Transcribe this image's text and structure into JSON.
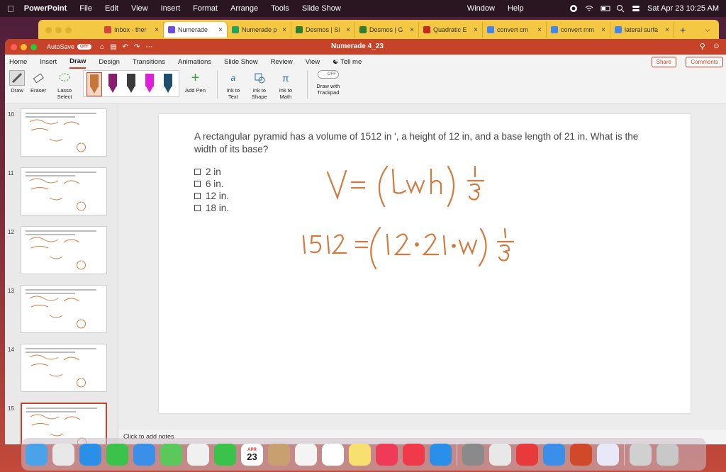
{
  "menubar": {
    "app": "PowerPoint",
    "items": [
      "File",
      "Edit",
      "View",
      "Insert",
      "Format",
      "Arrange",
      "Tools",
      "Slide Show"
    ],
    "window": "Window",
    "help": "Help",
    "datetime": "Sat Apr 23  10:25 AM"
  },
  "browser_tabs": [
    {
      "label": "Inbox - ther",
      "color": "#d44638"
    },
    {
      "label": "Numerade",
      "color": "#6a4ce0",
      "active": true
    },
    {
      "label": "Numerade p",
      "color": "#1fa463"
    },
    {
      "label": "Desmos | Si",
      "color": "#2e7d32"
    },
    {
      "label": "Desmos | G",
      "color": "#2e7d32"
    },
    {
      "label": "Quadratic E",
      "color": "#c62828"
    },
    {
      "label": "convert cm",
      "color": "#4285f4"
    },
    {
      "label": "convert mm",
      "color": "#4285f4"
    },
    {
      "label": "lateral surfa",
      "color": "#4285f4"
    }
  ],
  "ppt": {
    "autosave_label": "AutoSave",
    "autosave_state": "OFF",
    "doc_title": "Numerade 4_23",
    "ribbon_tabs": [
      "Home",
      "Insert",
      "Draw",
      "Design",
      "Transitions",
      "Animations",
      "Slide Show",
      "Review",
      "View",
      "Tell me"
    ],
    "share_label": "Share",
    "comments_label": "Comments",
    "tools": {
      "draw": "Draw",
      "eraser": "Eraser",
      "lasso": "Lasso Select",
      "add_pen": "Add Pen",
      "ink_text": "Ink to Text",
      "ink_shape": "Ink to Shape",
      "ink_math": "Ink to Math",
      "trackpad_toggle": "OFF",
      "trackpad": "Draw with Trackpad"
    },
    "pen_colors": [
      "#c6763a",
      "#8a1d6e",
      "#3a3a3a",
      "#e020d8",
      "#1f4e6e"
    ]
  },
  "thumbnails": [
    "10",
    "11",
    "12",
    "13",
    "14",
    "15"
  ],
  "slide": {
    "question": "A rectangular pyramid has a volume of 1512 in ', a height of 12 in, and a base length of 21 in. What is the width of its base?",
    "options": [
      "2 in",
      "6 in.",
      "12 in.",
      "18 in."
    ],
    "ink_line1": "V=(lwh)1/3",
    "ink_line2": "1512=(12·21·w)1/3",
    "ink_color": "#d07a40"
  },
  "notes_placeholder": "Click to add notes",
  "dock_apps": [
    "Finder",
    "Launchpad",
    "Safari",
    "Messages",
    "Mail",
    "Maps",
    "Photos",
    "FaceTime",
    "Calendar",
    "Contacts",
    "Reminders",
    "Chrome",
    "Notes",
    "Music",
    "News",
    "App Store",
    "System Preferences",
    "Vectorize",
    "Webex",
    "Zoom",
    "PowerPoint",
    "Numerade",
    "Preview",
    "Trash"
  ],
  "dock_calendar": {
    "month": "APR",
    "day": "23"
  }
}
